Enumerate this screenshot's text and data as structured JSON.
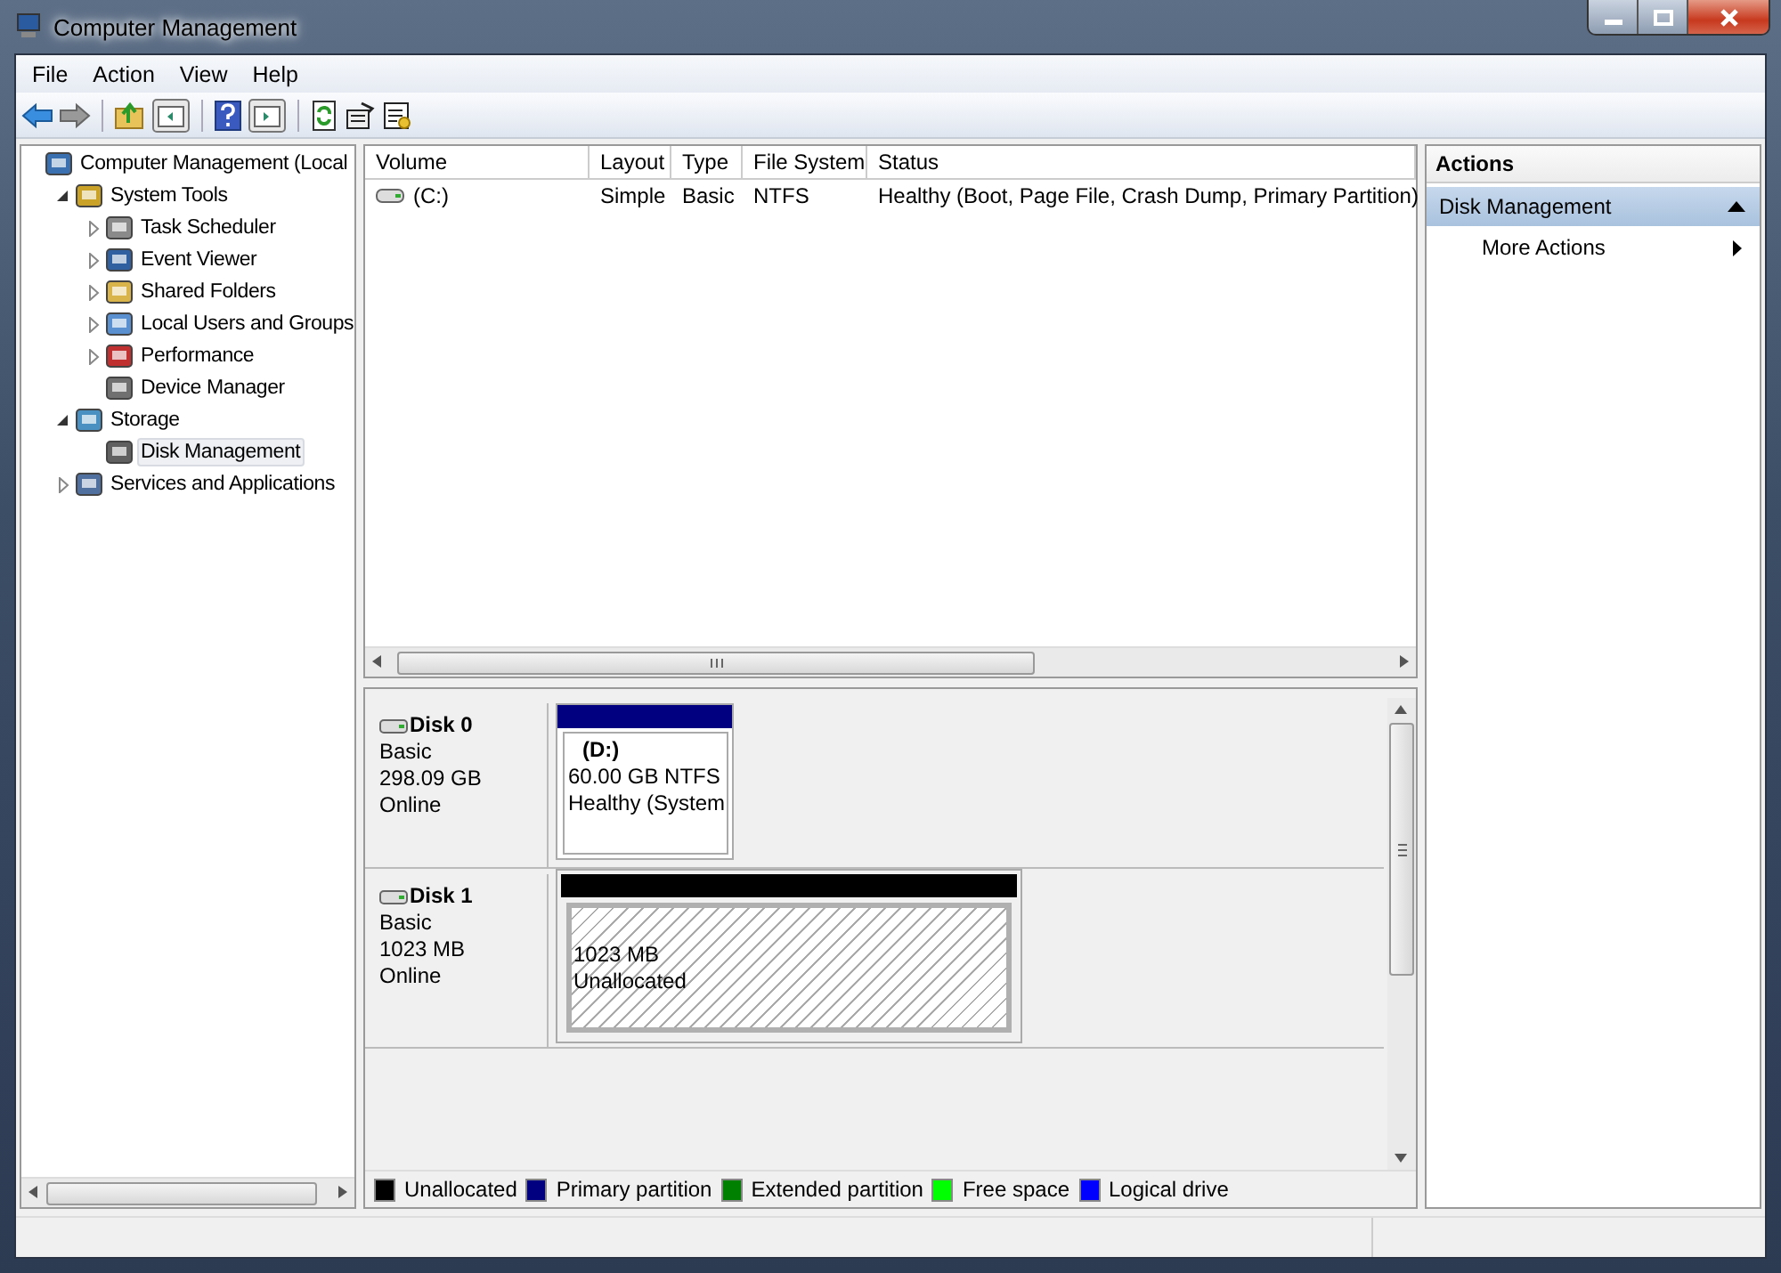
{
  "window": {
    "title": "Computer Management"
  },
  "menu": [
    "File",
    "Action",
    "View",
    "Help"
  ],
  "tree": [
    {
      "label": "Computer Management (Local",
      "selected": false,
      "children": [
        {
          "label": "System Tools",
          "selected": false,
          "expanded": true,
          "children": [
            {
              "label": "Task Scheduler",
              "selected": false,
              "expanded": false
            },
            {
              "label": "Event Viewer",
              "selected": false,
              "expanded": false
            },
            {
              "label": "Shared Folders",
              "selected": false,
              "expanded": false
            },
            {
              "label": "Local Users and Groups",
              "selected": false,
              "expanded": false
            },
            {
              "label": "Performance",
              "selected": false,
              "expanded": false
            },
            {
              "label": "Device Manager",
              "selected": false
            }
          ]
        },
        {
          "label": "Storage",
          "selected": false,
          "expanded": true,
          "children": [
            {
              "label": "Disk Management",
              "selected": true
            }
          ]
        },
        {
          "label": "Services and Applications",
          "selected": false,
          "expanded": false
        }
      ]
    }
  ],
  "volumes": {
    "columns": [
      "Volume",
      "Layout",
      "Type",
      "File System",
      "Status"
    ],
    "rows": [
      {
        "volume": "(C:)",
        "layout": "Simple",
        "type": "Basic",
        "file_system": "NTFS",
        "status": "Healthy (Boot, Page File, Crash Dump, Primary Partition)"
      }
    ]
  },
  "disks": [
    {
      "name": "Disk 0",
      "type": "Basic",
      "size": "298.09 GB",
      "status": "Online",
      "partitions": [
        {
          "kind": "volume",
          "color": "#000080",
          "name": "(D:)",
          "size": "60.00 GB NTFS",
          "status": "Healthy (System"
        }
      ]
    },
    {
      "name": "Disk 1",
      "type": "Basic",
      "size": "1023 MB",
      "status": "Online",
      "partitions": [
        {
          "kind": "unallocated",
          "color": "#000000",
          "size": "1023 MB",
          "status": "Unallocated"
        }
      ]
    }
  ],
  "legend": [
    {
      "label": "Unallocated",
      "color": "#000000"
    },
    {
      "label": "Primary partition",
      "color": "#000080"
    },
    {
      "label": "Extended partition",
      "color": "#008000"
    },
    {
      "label": "Free space",
      "color": "#00ff00"
    },
    {
      "label": "Logical drive",
      "color": "#0000ff"
    }
  ],
  "actions": {
    "title": "Actions",
    "section": {
      "label": "Disk Management",
      "expanded": true
    },
    "items": [
      {
        "label": "More Actions"
      }
    ]
  }
}
